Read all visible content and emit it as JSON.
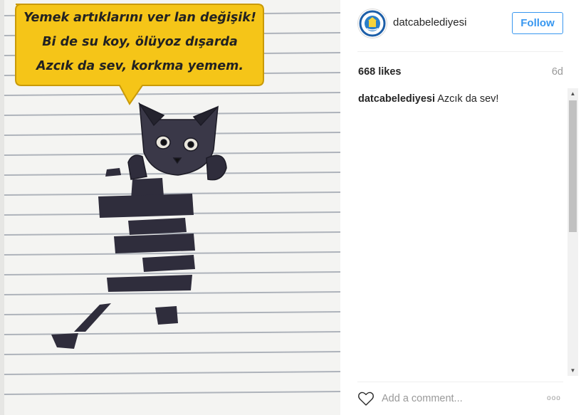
{
  "post": {
    "username": "datcabelediyesi",
    "follow_label": "Follow",
    "likes": "668 likes",
    "time_ago": "6d",
    "caption_user": "datcabelediyesi",
    "caption_text": "Azcık da sev!",
    "comment_placeholder": "Add a comment...",
    "more_label": "ooo"
  },
  "image": {
    "bubble_lines": [
      "Yemek artıklarını ver lan değişik!",
      "Bi de su koy, ölüyoz dışarda",
      "Azcık da sev, korkma yemem."
    ]
  },
  "icons": {
    "heart": "heart-outline-icon",
    "avatar": "municipality-logo",
    "scroll_up": "triangle-up-icon",
    "scroll_down": "triangle-down-icon"
  },
  "colors": {
    "accent": "#3897f0",
    "bubble": "#f5c518"
  }
}
